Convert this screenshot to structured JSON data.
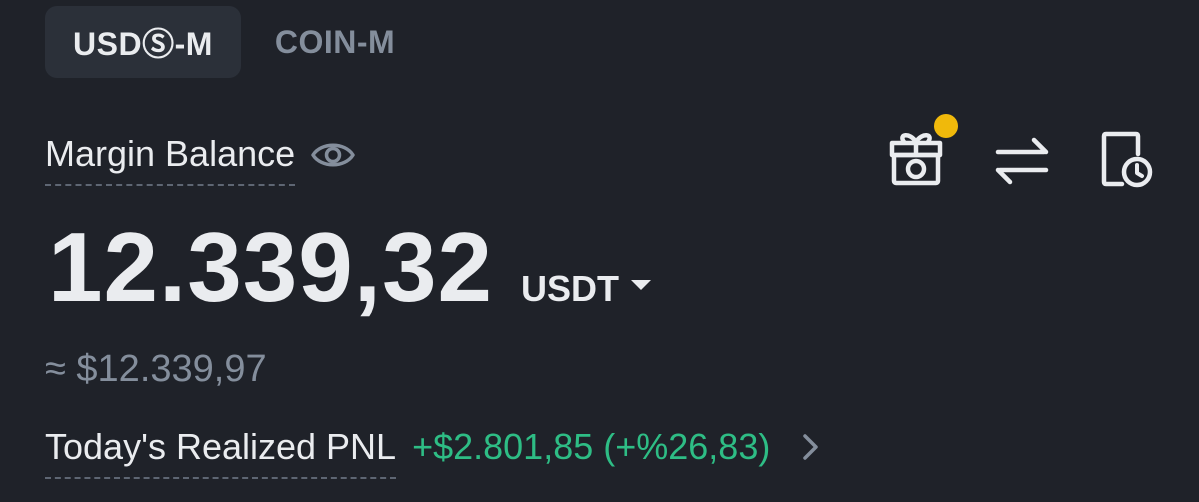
{
  "tabs": [
    {
      "label": "USDⓈ-M",
      "active": true
    },
    {
      "label": "COIN-M",
      "active": false
    }
  ],
  "balance_section": {
    "label": "Margin Balance",
    "value": "12.339,32",
    "currency": "USDT",
    "approx_usd": "≈ $12.339,97"
  },
  "header_icons": [
    {
      "name": "rewards-gift-icon",
      "has_notification_dot": true
    },
    {
      "name": "transfer-arrows-icon"
    },
    {
      "name": "history-document-icon"
    }
  ],
  "pnl": {
    "label": "Today's Realized PNL",
    "value": "+$2.801,85 (+%26,83)"
  },
  "colors": {
    "background": "#1f2229",
    "active_tab_bg": "#2b3039",
    "text_primary": "#eaecef",
    "text_secondary": "#848e9c",
    "positive": "#2ebd85",
    "notification": "#f0b90b"
  }
}
